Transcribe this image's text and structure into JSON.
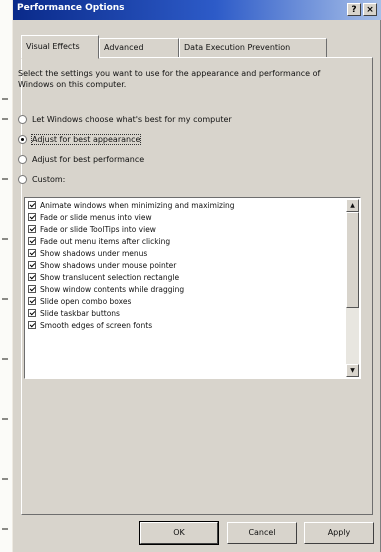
{
  "window": {
    "title": "Performance Options",
    "help_glyph": "?",
    "close_glyph": "×"
  },
  "tabs": [
    {
      "label": "Visual Effects",
      "active": true
    },
    {
      "label": "Advanced",
      "active": false
    },
    {
      "label": "Data Execution Prevention",
      "active": false
    }
  ],
  "description": "Select the settings you want to use for the appearance and performance of Windows on this computer.",
  "radios": [
    {
      "label": "Let Windows choose what's best for my computer",
      "selected": false
    },
    {
      "label": "Adjust for best appearance",
      "selected": true
    },
    {
      "label": "Adjust for best performance",
      "selected": false
    },
    {
      "label": "Custom:",
      "selected": false
    }
  ],
  "effects": [
    {
      "label": "Animate windows when minimizing and maximizing",
      "checked": true
    },
    {
      "label": "Fade or slide menus into view",
      "checked": true
    },
    {
      "label": "Fade or slide ToolTips into view",
      "checked": true
    },
    {
      "label": "Fade out menu items after clicking",
      "checked": true
    },
    {
      "label": "Show shadows under menus",
      "checked": true
    },
    {
      "label": "Show shadows under mouse pointer",
      "checked": true
    },
    {
      "label": "Show translucent selection rectangle",
      "checked": true
    },
    {
      "label": "Show window contents while dragging",
      "checked": true
    },
    {
      "label": "Slide open combo boxes",
      "checked": true
    },
    {
      "label": "Slide taskbar buttons",
      "checked": true
    },
    {
      "label": "Smooth edges of screen fonts",
      "checked": true
    }
  ],
  "scroll": {
    "up_glyph": "▲",
    "down_glyph": "▼"
  },
  "buttons": {
    "ok": "OK",
    "cancel": "Cancel",
    "apply": "Apply"
  }
}
